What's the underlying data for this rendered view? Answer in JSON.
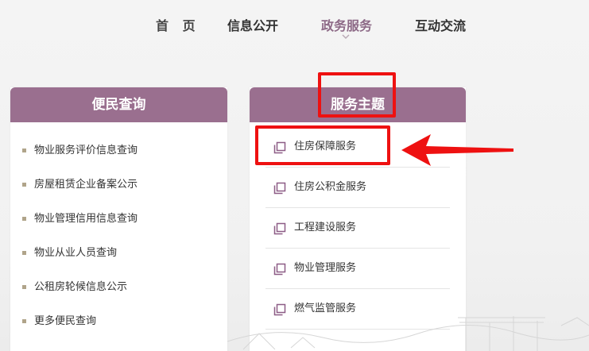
{
  "nav": {
    "items": [
      {
        "label": "首 页"
      },
      {
        "label": "信息公开"
      },
      {
        "label": "政务服务"
      },
      {
        "label": "互动交流"
      }
    ],
    "active_color": "#8d6a87"
  },
  "left_panel": {
    "title": "便民查询",
    "items": [
      {
        "label": "物业服务评价信息查询"
      },
      {
        "label": "房屋租赁企业备案公示"
      },
      {
        "label": "物业管理信用信息查询"
      },
      {
        "label": "物业从业人员查询"
      },
      {
        "label": "公租房轮候信息公示"
      },
      {
        "label": "更多便民查询"
      }
    ]
  },
  "right_panel": {
    "title": "服务主题",
    "items": [
      {
        "label": "住房保障服务",
        "icon": "copy-icon"
      },
      {
        "label": "住房公积金服务",
        "icon": "copy-icon"
      },
      {
        "label": "工程建设服务",
        "icon": "copy-icon"
      },
      {
        "label": "物业管理服务",
        "icon": "copy-icon"
      },
      {
        "label": "燃气监管服务",
        "icon": "copy-icon"
      }
    ]
  },
  "colors": {
    "header_bg": "#9a6f8f",
    "annotation": "#ee1111",
    "bullet": "#b0a48a"
  }
}
